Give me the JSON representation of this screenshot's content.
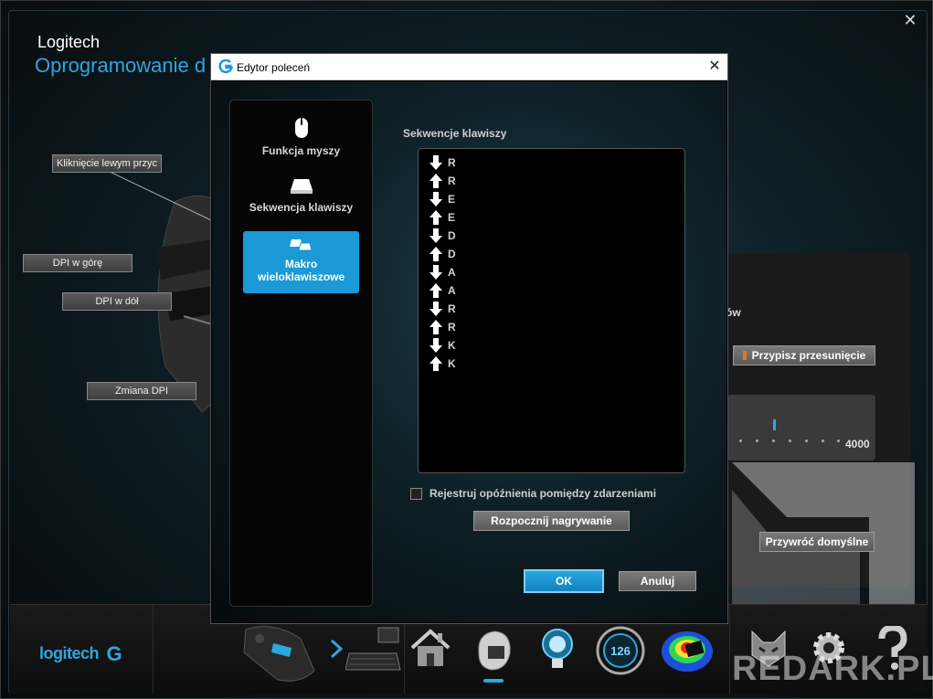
{
  "app": {
    "brand": "Logitech",
    "subtitle": "Oprogramowanie d",
    "close_glyph": "✕"
  },
  "callouts": {
    "left_click": "Kliknięcie lewym przyc",
    "dpi_up": "DPI w górę",
    "dpi_down": "DPI w dół",
    "dpi_change": "Zmiana DPI"
  },
  "right_panel": {
    "partial_text": "ów",
    "assign_shift_button": "Przypisz przesunięcie",
    "slider_max": "4000",
    "restore_defaults_button": "Przywróć domyślne"
  },
  "dialog": {
    "title": "Edytor poleceń",
    "close_glyph": "✕",
    "nav": [
      {
        "label": "Funkcja myszy",
        "icon": "mouse-icon",
        "active": false
      },
      {
        "label": "Sekwencja klawiszy",
        "icon": "key-icon",
        "active": false
      },
      {
        "label": "Makro wieloklawiszowe",
        "icon": "multi-key-icon",
        "active": true
      }
    ],
    "sequence_label": "Sekwencje klawiszy",
    "sequence": [
      {
        "dir": "down",
        "key": "R"
      },
      {
        "dir": "up",
        "key": "R"
      },
      {
        "dir": "down",
        "key": "E"
      },
      {
        "dir": "up",
        "key": "E"
      },
      {
        "dir": "down",
        "key": "D"
      },
      {
        "dir": "up",
        "key": "D"
      },
      {
        "dir": "down",
        "key": "A"
      },
      {
        "dir": "up",
        "key": "A"
      },
      {
        "dir": "down",
        "key": "R"
      },
      {
        "dir": "up",
        "key": "R"
      },
      {
        "dir": "down",
        "key": "K"
      },
      {
        "dir": "up",
        "key": "K"
      }
    ],
    "record_delays_label": "Rejestruj opóźnienia pomiędzy zdarzeniami",
    "record_delays_checked": false,
    "start_recording_button": "Rozpocznij nagrywanie",
    "ok_button": "OK",
    "cancel_button": "Anuluj"
  },
  "taskbar": {
    "logo_text": "logitech",
    "icons": [
      "mouse-device-icon",
      "next-arrow-icon",
      "keyboard-device-icon",
      "home-icon",
      "customize-buttons-icon",
      "lighting-icon",
      "dpi-gauge-icon",
      "heatmap-icon",
      "profile-icon",
      "settings-icon",
      "help-icon"
    ],
    "gauge_value": "126"
  },
  "watermark": "REDARK.PL",
  "colors": {
    "accent": "#2ea6de",
    "active_nav": "#1a9ad6"
  }
}
